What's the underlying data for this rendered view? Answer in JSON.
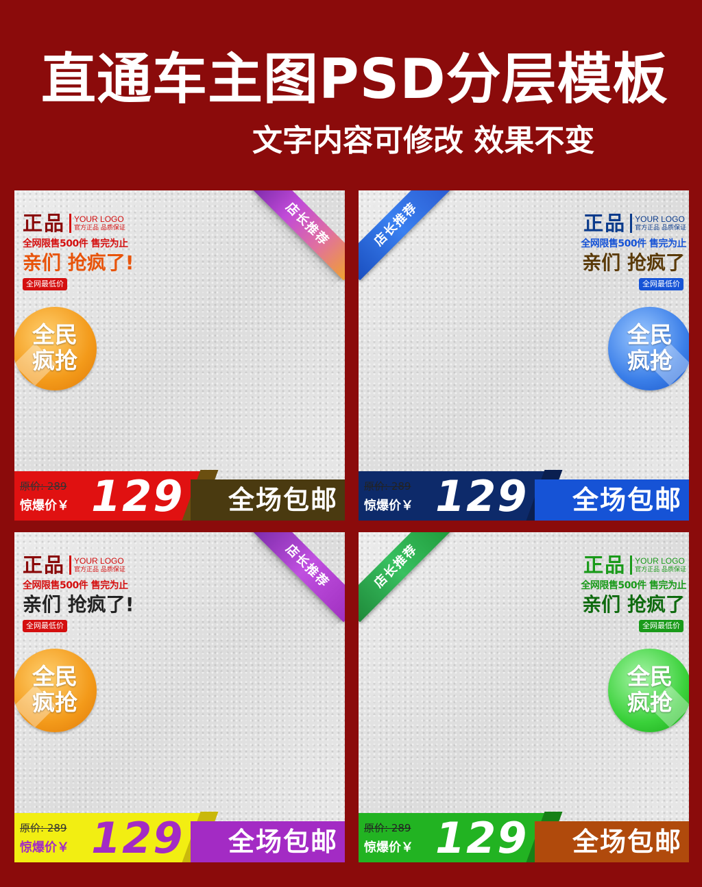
{
  "header": {
    "title": "直通车主图PSD分层模板",
    "subtitle": "文字内容可修改  效果不变"
  },
  "common": {
    "zhengpin": "正品",
    "your_logo": "YOUR LOGO",
    "guarantee": "官方正品 品质保证",
    "limit": "全网限售500件   售完为止",
    "slogan": "亲们 抢疯了!",
    "slogan_no_excl": "亲们 抢疯了",
    "lowest": "全网最低价",
    "circle_line1": "全民",
    "circle_line2": "疯抢",
    "ribbon": "店长推荐",
    "orig_price": "原价: 289",
    "surprise_label": "惊爆价￥",
    "price": "129",
    "free_ship": "全场包邮"
  },
  "colors": {
    "bg": "#8b0b0b",
    "card1": {
      "accent": "#d40f0f",
      "slogan": "#e8540b",
      "circle": "#f39a1a",
      "ribbon": "#9b2fc0",
      "band_left": "#e01111",
      "band_right": "#4a3a10"
    },
    "card2": {
      "accent": "#0b3b8c",
      "slogan": "#5a3a08",
      "circle": "#3a7ee8",
      "ribbon": "#2065d8",
      "band_left": "#0d2a6a",
      "band_right": "#1653d6"
    },
    "card3": {
      "accent": "#d40f0f",
      "slogan": "#222222",
      "circle": "#f39a1a",
      "ribbon": "#a833c8",
      "band_left": "#f2ee12",
      "band_right": "#a32bc4"
    },
    "card4": {
      "accent": "#1a9a1a",
      "slogan": "#0e6a0e",
      "circle": "#3ad13a",
      "ribbon": "#1f9a3a",
      "band_left": "#22b322",
      "band_right": "#b04a0c"
    }
  }
}
